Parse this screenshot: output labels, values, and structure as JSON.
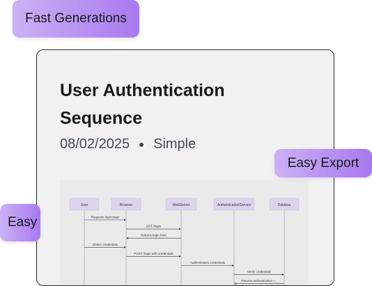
{
  "badges": {
    "fast": "Fast Generations",
    "export": "Easy Export",
    "easy": "Easy"
  },
  "card": {
    "title": "User Authentication Sequence",
    "date": "08/02/2025",
    "type": "Simple"
  },
  "diagram": {
    "participants": [
      "User",
      "Browser",
      "WebServer",
      "AuthenticationService",
      "Databas"
    ],
    "messages": [
      {
        "from": 0,
        "to": 1,
        "label": "Requests login page"
      },
      {
        "from": 1,
        "to": 2,
        "label": "GET /login"
      },
      {
        "from": 2,
        "to": 1,
        "label": "Returns login form"
      },
      {
        "from": 0,
        "to": 1,
        "label": "Enters credentials"
      },
      {
        "from": 1,
        "to": 2,
        "label": "POST /login with credentials"
      },
      {
        "from": 2,
        "to": 3,
        "label": "Authenticates credentials"
      },
      {
        "from": 3,
        "to": 4,
        "label": "Verify credentials"
      },
      {
        "from": 4,
        "to": 3,
        "label": "Returns authentication r..."
      }
    ]
  }
}
